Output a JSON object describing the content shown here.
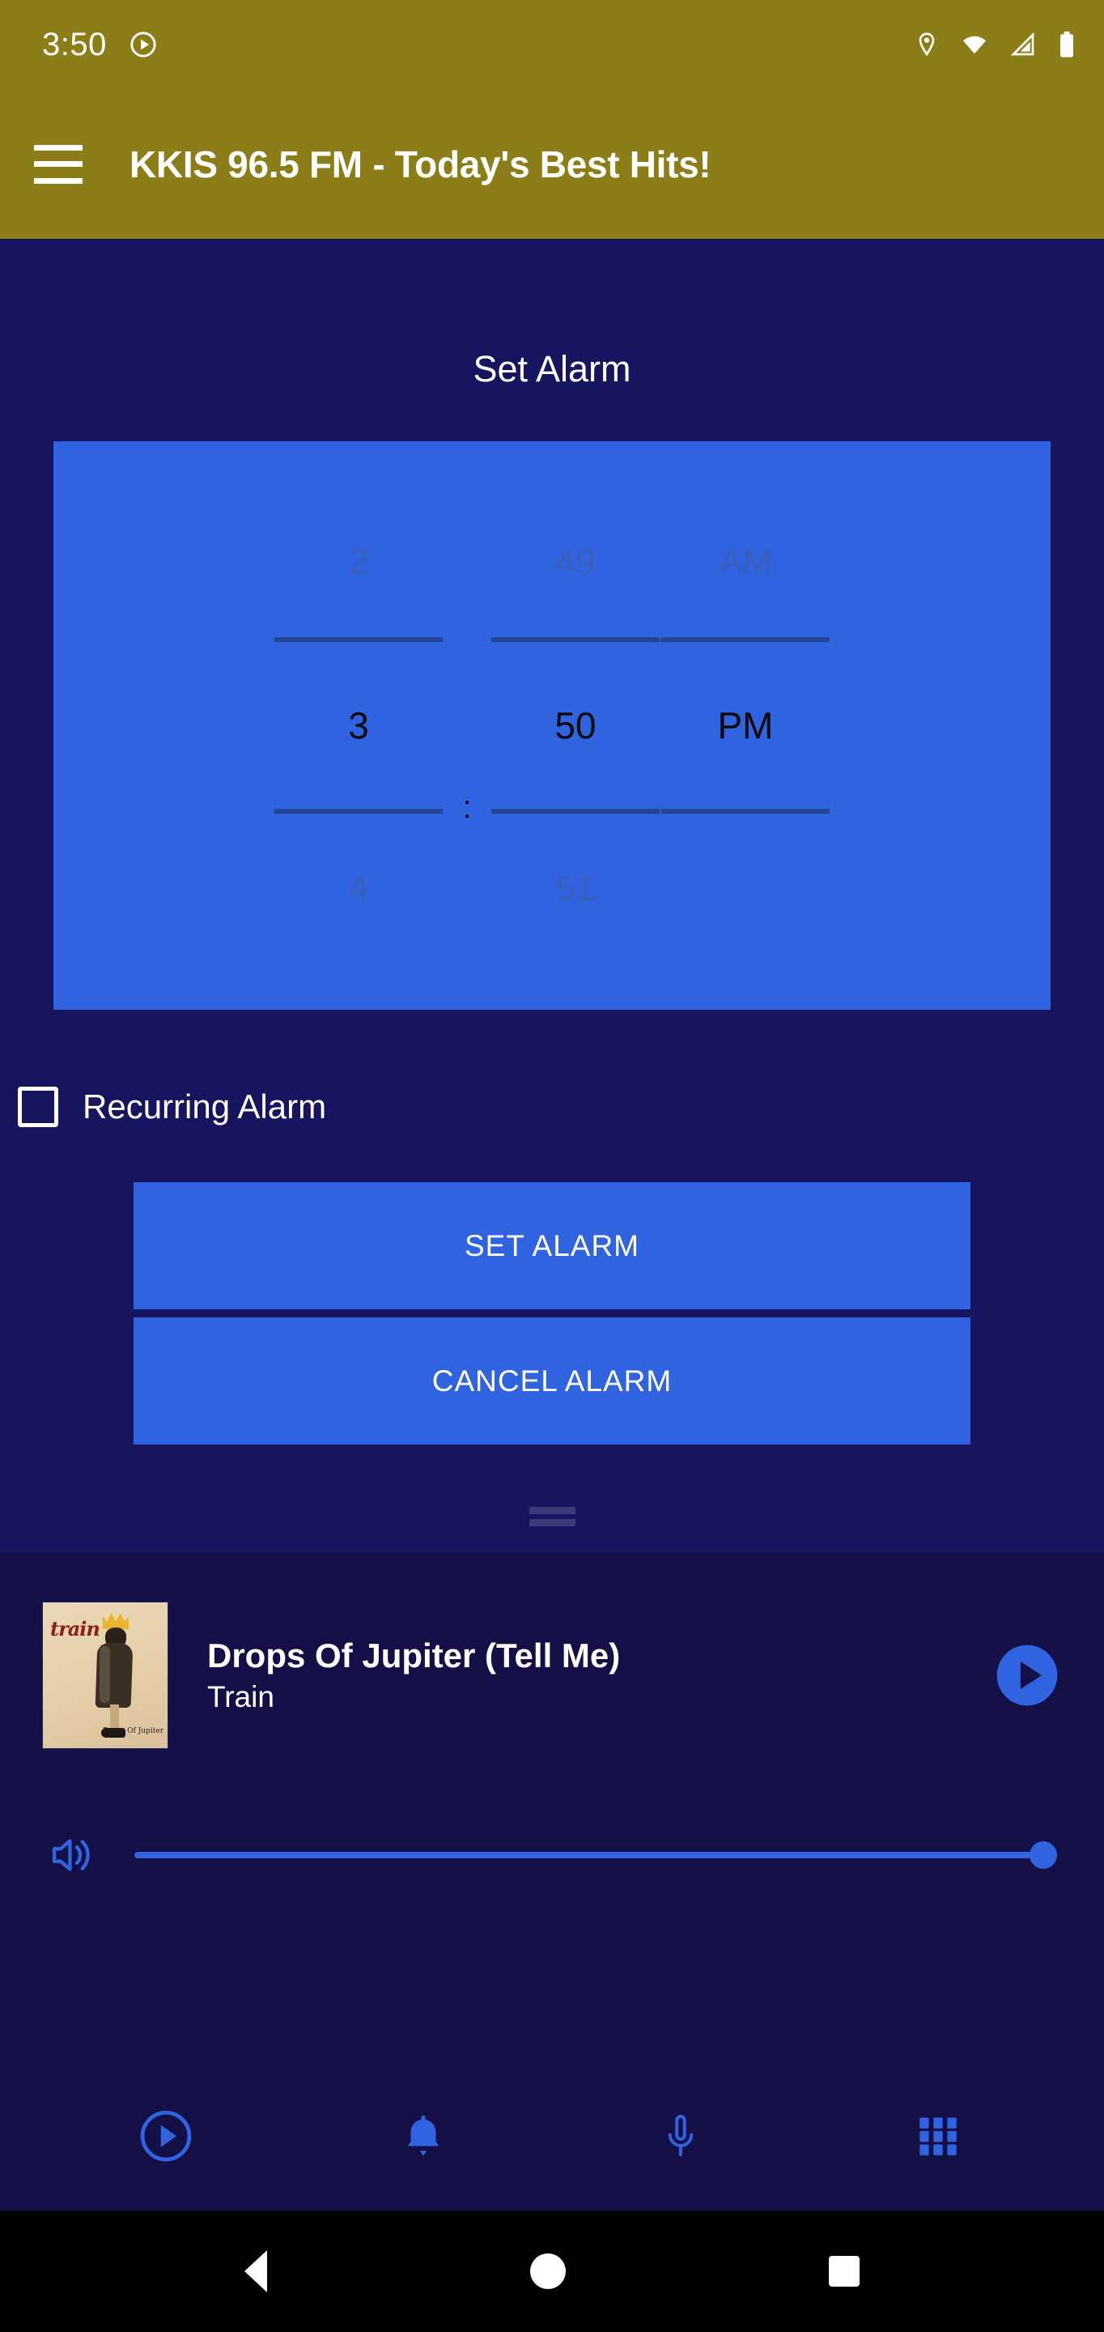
{
  "status_bar": {
    "clock": "3:50",
    "icons": [
      "media-play-icon",
      "location-pin-icon",
      "wifi-icon",
      "cellular-signal-icon",
      "battery-icon"
    ],
    "background_color": "#8B7D18"
  },
  "app_bar": {
    "menu_icon": "hamburger-menu-icon",
    "title": "KKIS 96.5 FM - Today's Best Hits!",
    "background_color": "#8B7D18",
    "text_color": "#FFFFFF"
  },
  "main": {
    "background_color": "#181560",
    "section_title": "Set Alarm",
    "time_picker": {
      "background_color": "#3063DF",
      "hour": {
        "previous": "2",
        "selected": "3",
        "next": "4"
      },
      "separator": ":",
      "minute": {
        "previous": "49",
        "selected": "50",
        "next": "51"
      },
      "meridiem": {
        "previous": "AM",
        "selected": "PM",
        "next": ""
      }
    },
    "recurring": {
      "label": "Recurring Alarm",
      "checked": false
    },
    "buttons": {
      "set_alarm": "SET ALARM",
      "cancel_alarm": "CANCEL ALARM",
      "color": "#3063DF"
    }
  },
  "player": {
    "drag_handle": "drag-handle",
    "background_color": "#141047",
    "album_art_alt": "train",
    "album_art_caption": "Drops Of Jupiter",
    "track_title": "Drops Of Jupiter (Tell Me)",
    "track_artist": "Train",
    "play_button": "play-icon",
    "accent_color": "#3063DF",
    "volume": {
      "icon": "speaker-volume-icon",
      "value": 100
    }
  },
  "bottom_nav": {
    "items": [
      {
        "name": "play-circle-icon",
        "label": "Play"
      },
      {
        "name": "bell-icon",
        "label": "Alarm"
      },
      {
        "name": "microphone-icon",
        "label": "Microphone"
      },
      {
        "name": "apps-grid-icon",
        "label": "Apps"
      }
    ],
    "color": "#3063DF"
  },
  "android_nav": {
    "back": "back-triangle-icon",
    "home": "home-circle-icon",
    "recents": "recents-square-icon",
    "background_color": "#000000"
  }
}
